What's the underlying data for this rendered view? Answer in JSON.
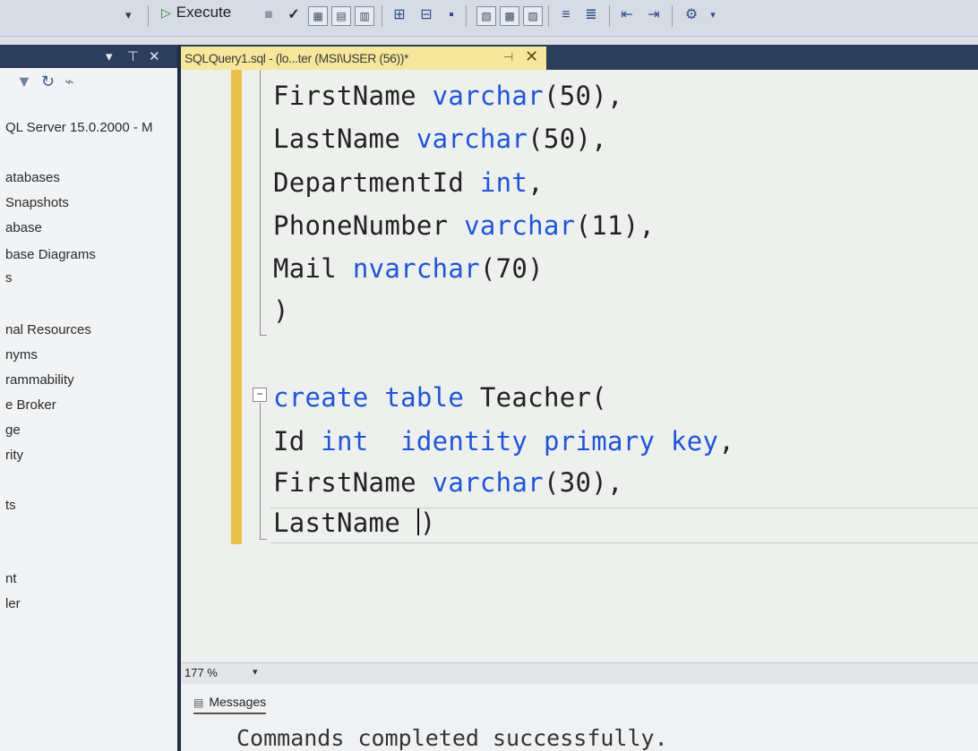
{
  "toolbar": {
    "execute_label": "Execute",
    "db_dropdown_arrow": "▾"
  },
  "explorer": {
    "pin": "▾ ⊤ ✕",
    "server": "QL Server 15.0.2000 - M",
    "items": [
      "atabases",
      "Snapshots",
      "abase",
      "base Diagrams",
      "s",
      "nal Resources",
      "nyms",
      "rammability",
      "e Broker",
      "ge",
      "rity",
      "ts",
      "nt",
      "ler"
    ]
  },
  "tab": {
    "title": "SQLQuery1.sql - (lo...ter (MSI\\USER (56))*"
  },
  "editor": {
    "lines": [
      {
        "text": "FirstName ",
        "kw": "varchar",
        "rest": "(50),"
      },
      {
        "text": "LastName ",
        "kw": "varchar",
        "rest": "(50),"
      },
      {
        "text": "DepartmentId ",
        "kw": "int",
        "rest": ","
      },
      {
        "text": "PhoneNumber ",
        "kw": "varchar",
        "rest": "(11),"
      },
      {
        "text": "Mail ",
        "kw": "nvarchar",
        "rest": "(70)"
      },
      {
        "text": ")",
        "kw": "",
        "rest": ""
      }
    ],
    "create_kw1": "create",
    "create_kw2": "table",
    "create_rest": " Teacher(",
    "id_name": "Id ",
    "id_kw1": "int",
    "id_kw2": "identity",
    "id_kw3": "primary",
    "id_kw4": "key",
    "id_rest": ",",
    "first_name": "FirstName ",
    "first_kw": "varchar",
    "first_rest": "(30),",
    "last_name": "LastName ",
    "last_rest": ")"
  },
  "zoom": {
    "level": "177 %"
  },
  "results": {
    "tab_label": "Messages",
    "message": "Commands completed successfully."
  },
  "colors": {
    "keyword": "#1f56d8",
    "tab_active": "#f6e79a",
    "change_bar": "#e8c24a"
  }
}
